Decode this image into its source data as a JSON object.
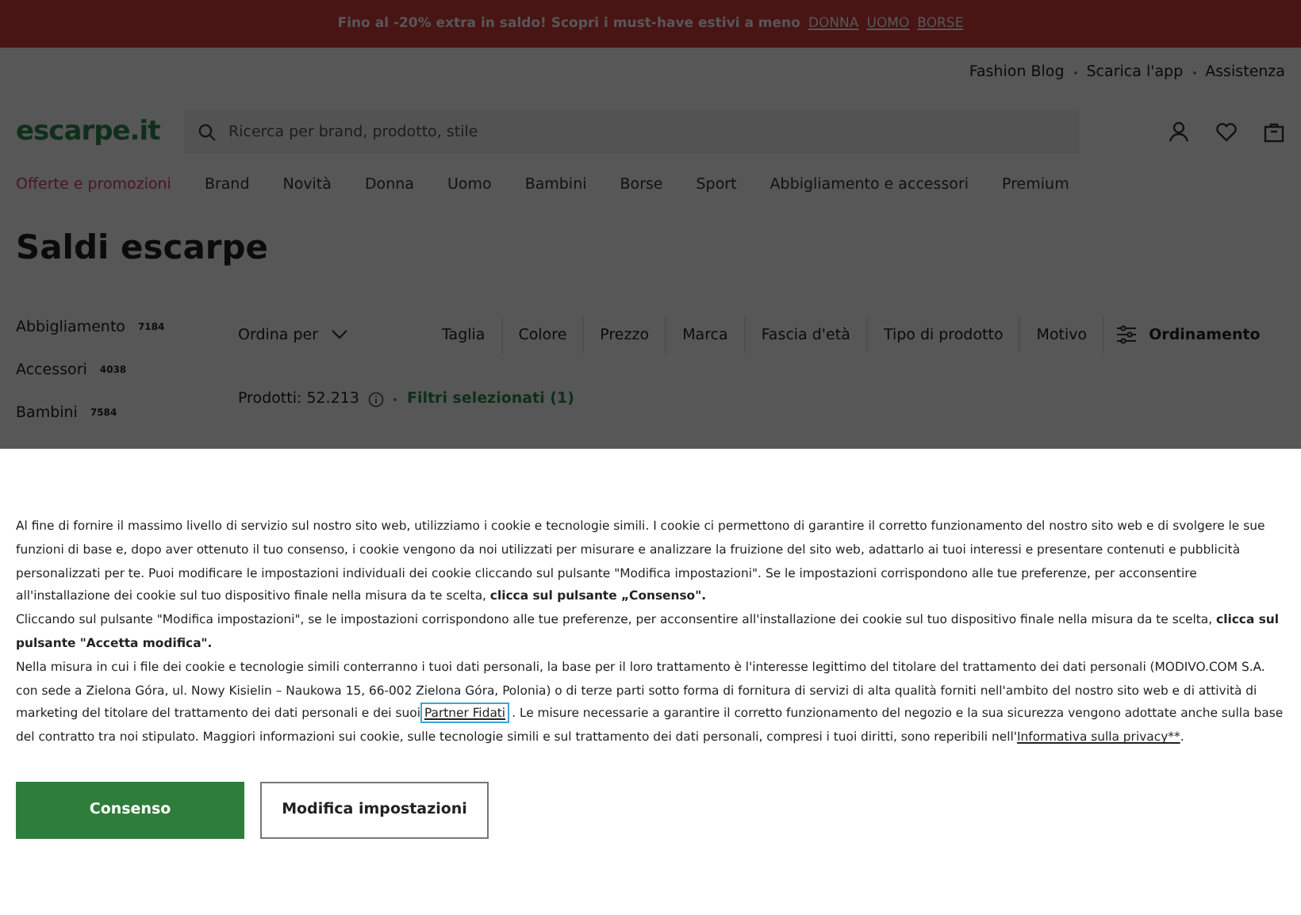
{
  "promo_bar": {
    "text": "Fino al -20% extra in saldo! Scopri i must-have estivi a meno",
    "links": [
      "DONNA",
      "UOMO",
      "BORSE"
    ]
  },
  "top_links": [
    "Fashion Blog",
    "Scarica l'app",
    "Assistenza"
  ],
  "header": {
    "logo": "escarpe.it",
    "search": {
      "placeholder": "Ricerca per brand, prodotto, stile"
    }
  },
  "nav": [
    {
      "label": "Offerte e promozioni",
      "highlighted": true
    },
    {
      "label": "Brand",
      "highlighted": false
    },
    {
      "label": "Novità",
      "highlighted": false
    },
    {
      "label": "Donna",
      "highlighted": false
    },
    {
      "label": "Uomo",
      "highlighted": false
    },
    {
      "label": "Bambini",
      "highlighted": false
    },
    {
      "label": "Borse",
      "highlighted": false
    },
    {
      "label": "Sport",
      "highlighted": false
    },
    {
      "label": "Abbigliamento e accessori",
      "highlighted": false
    },
    {
      "label": "Premium",
      "highlighted": false
    }
  ],
  "page_title": "Saldi escarpe",
  "categories": [
    {
      "name": "Abbigliamento",
      "count": "7184"
    },
    {
      "name": "Accessori",
      "count": "4038"
    },
    {
      "name": "Bambini",
      "count": "7584"
    }
  ],
  "filters": {
    "sort": "Ordina per",
    "items": [
      "Taglia",
      "Colore",
      "Prezzo",
      "Marca",
      "Fascia d'età",
      "Tipo di prodotto",
      "Motivo"
    ],
    "sort_button": "Ordinamento"
  },
  "products": {
    "count": "Prodotti: 52.213",
    "selected_filters": "Filtri selezionati (1)"
  },
  "consent": {
    "paragraphs": [
      "Al fine di fornire il massimo livello di servizio sul nostro sito web, utilizziamo i cookie e tecnologie simili. I cookie ci permettono di garantire il corretto funzionamento del nostro sito web e di svolgere le sue funzioni di base e, dopo aver ottenuto il tuo consenso, i cookie vengono da noi utilizzati per misurare e analizzare la fruizione del sito web, adattarlo ai tuoi interessi e presentare contenuti e pubblicità personalizzati per te. Puoi modificare le impostazioni individuali dei cookie cliccando sul pulsante \"Modifica impostazioni\". Se le impostazioni corrispondono alle tue preferenze, per acconsentire all'installazione dei cookie sul tuo dispositivo finale nella misura da te scelta, **clicca sul pulsante „Consenso\".**",
      "Cliccando sul pulsante \"Modifica impostazioni\", se le impostazioni corrispondono alle tue preferenze, per acconsentire all'installazione dei cookie sul tuo dispositivo finale nella misura da te scelta, **clicca sul pulsante \"Accetta modifica\".**"
    ],
    "last_paragraph": {
      "before": "Nella misura in cui i file dei cookie e tecnologie simili conterranno i tuoi dati personali, la base per il loro trattamento è l'interesse legittimo del titolare del trattamento dei dati personali (MODIVO.COM S.A. con sede a Zielona Góra, ul. Nowy Kisielin – Naukowa 15, 66-002 Zielona Góra, Polonia) o di terze parti sotto forma di fornitura di servizi di alta qualità forniti nell'ambito del nostro sito web e di attività di marketing del titolare del trattamento dei dati personali e dei suoi",
      "partners_link": "Partner Fidati",
      "middle": ". Le misure necessarie a garantire il corretto funzionamento del negozio e la sua sicurezza vengono adottate anche sulla base del contratto tra noi stipulato. Maggiori informazioni sui cookie, sulle tecnologie simili e sul trattamento dei dati personali, compresi i tuoi diritti, sono reperibili nell'",
      "privacy_link": "Informativa sulla privacy**",
      "after": "."
    },
    "buttons": [
      {
        "label": "Consenso",
        "kind": "primary"
      },
      {
        "label": "Modifica impostazioni",
        "kind": "secondary"
      }
    ]
  }
}
